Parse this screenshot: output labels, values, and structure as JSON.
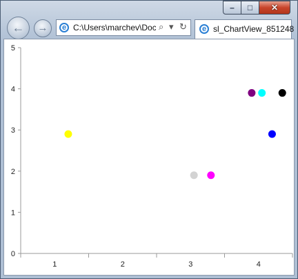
{
  "window": {
    "minimize_glyph": "–",
    "maximize_glyph": "□",
    "close_glyph": "✕"
  },
  "nav": {
    "back_glyph": "←",
    "forward_glyph": "→"
  },
  "address_bar": {
    "value": "C:\\Users\\marchev\\Doc",
    "search_glyph": "⌕",
    "dropdown_glyph": "▾",
    "refresh_glyph": "↻",
    "icon": "ie-icon"
  },
  "tab": {
    "title": "sl_ChartView_851248",
    "icon": "ie-icon"
  },
  "chart_data": {
    "type": "scatter",
    "title": "",
    "xlabel": "",
    "ylabel": "",
    "xlim": [
      0.5,
      4.5
    ],
    "ylim": [
      0,
      5
    ],
    "x_ticks": [
      "1",
      "2",
      "3",
      "4"
    ],
    "y_ticks": [
      "0",
      "1",
      "2",
      "3",
      "4",
      "5"
    ],
    "grid": false,
    "series": [
      {
        "x": 1.2,
        "y": 2.9,
        "color": "#ffff00"
      },
      {
        "x": 3.05,
        "y": 1.9,
        "color": "#d3d3d3"
      },
      {
        "x": 3.3,
        "y": 1.9,
        "color": "#ff00ff"
      },
      {
        "x": 3.9,
        "y": 3.9,
        "color": "#800080"
      },
      {
        "x": 4.05,
        "y": 3.9,
        "color": "#00ffff"
      },
      {
        "x": 4.2,
        "y": 2.9,
        "color": "#0000ff"
      },
      {
        "x": 4.35,
        "y": 3.9,
        "color": "#000000"
      }
    ]
  }
}
